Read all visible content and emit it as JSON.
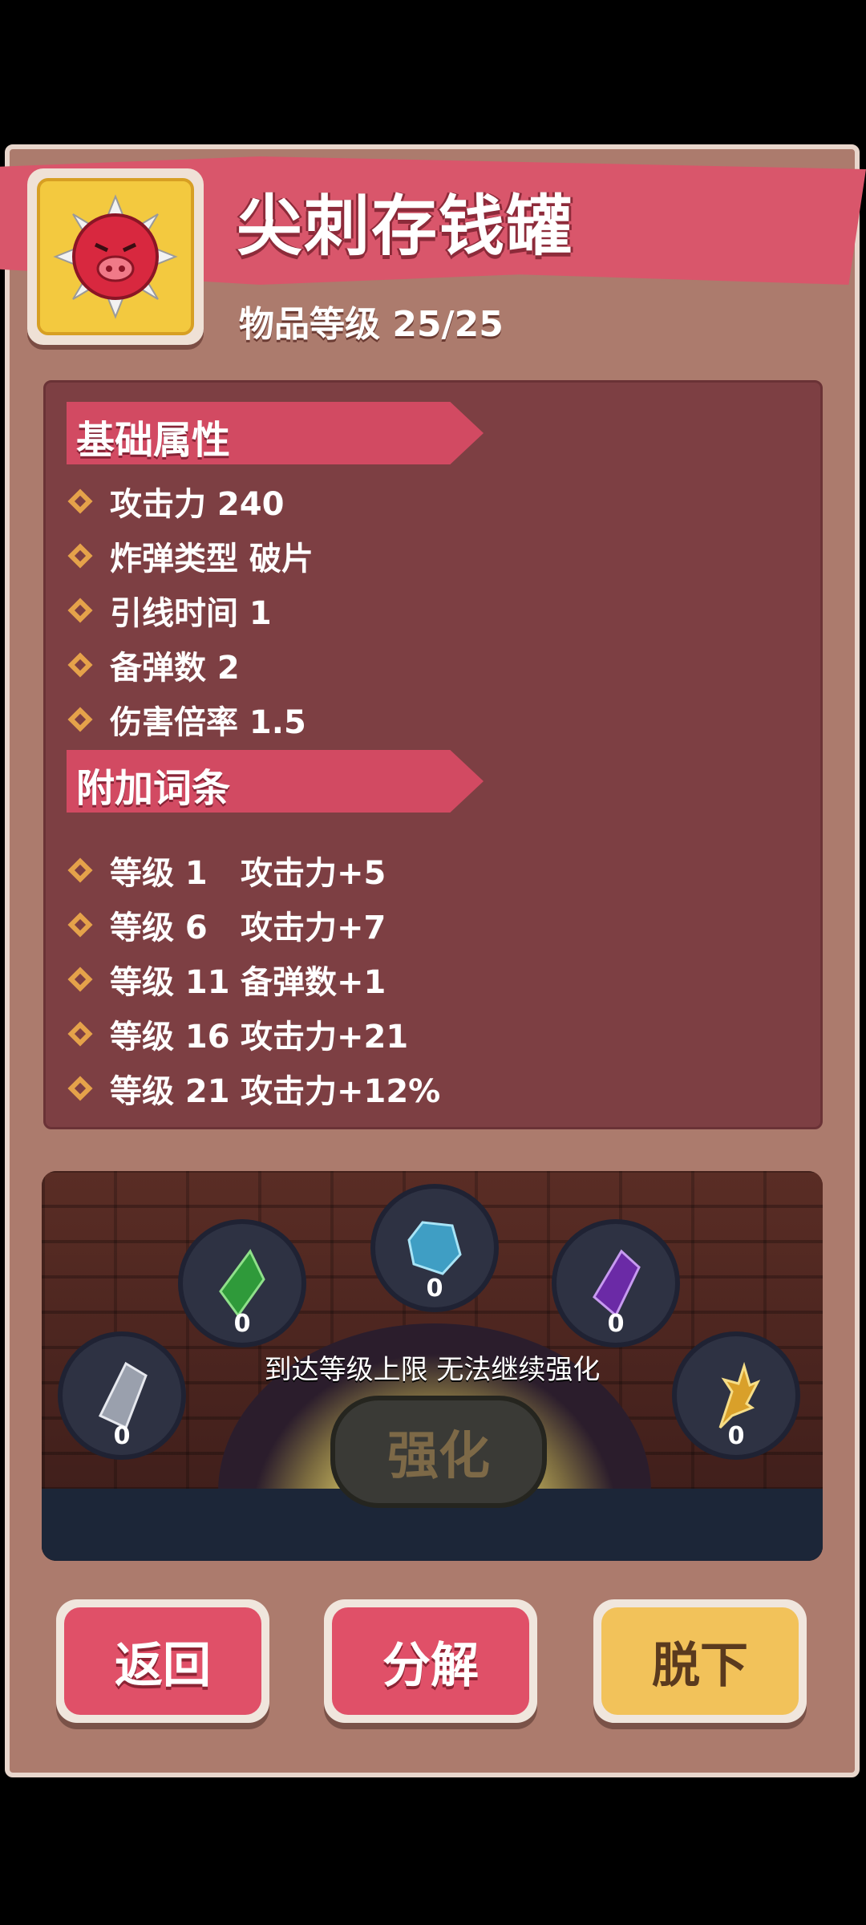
{
  "item": {
    "name": "尖刺存钱罐",
    "level_text": "物品等级 25/25",
    "icon": "spiky-piggy-bank-icon"
  },
  "base_stats": {
    "header": "基础属性",
    "rows": [
      "攻击力 240",
      "炸弹类型 破片",
      "引线时间 1",
      "备弹数 2",
      "伤害倍率 1.5"
    ]
  },
  "affixes": {
    "header": "附加词条",
    "rows": [
      {
        "level": "等级 1",
        "effect": "攻击力+5"
      },
      {
        "level": "等级 6",
        "effect": "攻击力+7"
      },
      {
        "level": "等级 11",
        "effect": "备弹数+1"
      },
      {
        "level": "等级 16",
        "effect": "攻击力+21"
      },
      {
        "level": "等级 21",
        "effect": "攻击力+12%"
      }
    ]
  },
  "enhance": {
    "slots": [
      {
        "name": "gray-crystal-icon",
        "count": "0",
        "color": "#9aa0ad"
      },
      {
        "name": "green-crystal-icon",
        "count": "0",
        "color": "#2f9a3a"
      },
      {
        "name": "blue-crystal-icon",
        "count": "0",
        "color": "#3f9ec4"
      },
      {
        "name": "purple-crystal-icon",
        "count": "0",
        "color": "#6b2aa6"
      },
      {
        "name": "gold-feather-icon",
        "count": "0",
        "color": "#d9a02a"
      }
    ],
    "message": "到达等级上限 无法继续强化",
    "button": "强化"
  },
  "buttons": {
    "back": "返回",
    "decompose": "分解",
    "unequip": "脱下"
  },
  "colors": {
    "title_band": "#d9566b",
    "panel": "#ac7b6d",
    "stats_bg": "#7d3f43",
    "gold_button": "#f2c25a",
    "red_button": "#e05068"
  }
}
